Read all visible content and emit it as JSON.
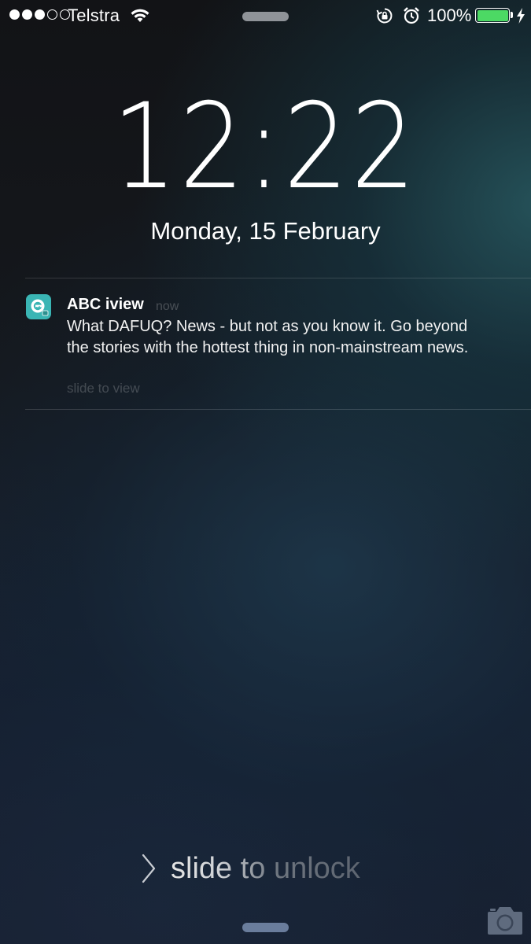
{
  "status_bar": {
    "signal_bars_filled": 3,
    "signal_bars_total": 5,
    "carrier": "Telstra",
    "wifi_icon": "wifi-icon",
    "rotation_lock_icon": "rotation-lock-icon",
    "alarm_icon": "alarm-icon",
    "battery_percent": "100%",
    "battery_level": 1.0,
    "charging_icon": "bolt-icon",
    "battery_color": "#4cd964"
  },
  "lock_screen": {
    "time": "12:22",
    "date": "Monday, 15 February"
  },
  "notification": {
    "app_icon": "abc-iview-app-icon",
    "app_icon_color": "#3ab5b4",
    "app_name": "ABC iview",
    "time": "now",
    "message": "What DAFUQ? News - but not as you know it. Go beyond the stories with the hottest thing in non-mainstream news.",
    "action_hint": "slide to view"
  },
  "bottom": {
    "unlock_text": "slide to unlock",
    "camera_icon": "camera-icon"
  }
}
